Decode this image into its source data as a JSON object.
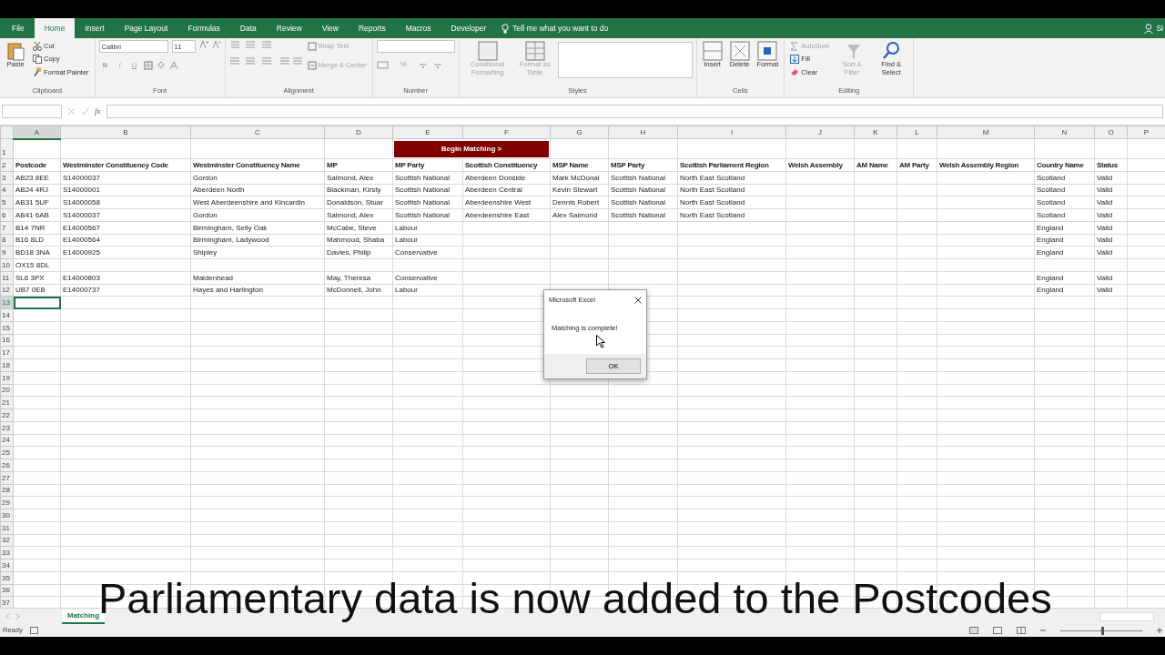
{
  "menu_tabs": [
    {
      "label": "File",
      "selected": false
    },
    {
      "label": "Home",
      "selected": true
    },
    {
      "label": "Insert",
      "selected": false
    },
    {
      "label": "Page Layout",
      "selected": false
    },
    {
      "label": "Formulas",
      "selected": false
    },
    {
      "label": "Data",
      "selected": false
    },
    {
      "label": "Review",
      "selected": false
    },
    {
      "label": "View",
      "selected": false
    },
    {
      "label": "Reports",
      "selected": false
    },
    {
      "label": "Macros",
      "selected": false
    },
    {
      "label": "Developer",
      "selected": false
    }
  ],
  "tell_me": "Tell me what you want to do",
  "account": "Si",
  "ribbon": [
    {
      "kind": "clipboard",
      "label": "Clipboard",
      "buttons": [
        {
          "label": "Paste",
          "disabled": false
        },
        {
          "label": "Cut",
          "disabled": false
        },
        {
          "label": "Copy",
          "disabled": false
        },
        {
          "label": "Format Painter",
          "disabled": false
        }
      ]
    },
    {
      "kind": "font",
      "label": "Font",
      "font": "Calibri",
      "size": "11",
      "buttons": [
        {
          "label": "B",
          "disabled": true
        },
        {
          "label": "I",
          "disabled": true
        },
        {
          "label": "U",
          "disabled": true
        }
      ]
    },
    {
      "kind": "alignment",
      "label": "Alignment",
      "buttons": [
        {
          "label": "Wrap Text",
          "disabled": true
        },
        {
          "label": "Merge & Center",
          "disabled": true
        }
      ]
    },
    {
      "kind": "number",
      "label": "Number",
      "buttons": [
        {
          "label": "%",
          "disabled": true
        }
      ]
    },
    {
      "kind": "styles",
      "label": "Styles",
      "buttons": [
        {
          "label": "Conditional Formatting",
          "disabled": true
        },
        {
          "label": "Format as Table",
          "disabled": true
        }
      ]
    },
    {
      "kind": "cells",
      "label": "Cells",
      "buttons": [
        {
          "label": "Insert",
          "disabled": false
        },
        {
          "label": "Delete",
          "disabled": false
        },
        {
          "label": "Format",
          "disabled": false
        }
      ]
    },
    {
      "kind": "editing",
      "label": "Editing",
      "buttons": [
        {
          "label": "AutoSum",
          "disabled": true
        },
        {
          "label": "Fill",
          "disabled": false
        },
        {
          "label": "Clear",
          "disabled": false
        },
        {
          "label": "Sort & Filter",
          "disabled": true
        },
        {
          "label": "Find & Select",
          "disabled": false
        }
      ]
    }
  ],
  "formula_bar": {
    "function_label": "fx"
  },
  "columns": [
    {
      "letter": "A",
      "selected": true
    },
    {
      "letter": "B",
      "selected": false
    },
    {
      "letter": "C",
      "selected": false
    },
    {
      "letter": "D",
      "selected": false
    },
    {
      "letter": "E",
      "selected": false
    },
    {
      "letter": "F",
      "selected": false
    },
    {
      "letter": "G",
      "selected": false
    },
    {
      "letter": "H",
      "selected": false
    },
    {
      "letter": "I",
      "selected": false
    },
    {
      "letter": "J",
      "selected": false
    },
    {
      "letter": "K",
      "selected": false
    },
    {
      "letter": "L",
      "selected": false
    },
    {
      "letter": "M",
      "selected": false
    },
    {
      "letter": "N",
      "selected": false
    },
    {
      "letter": "O",
      "selected": false
    },
    {
      "letter": "P",
      "selected": false
    }
  ],
  "rows": [
    {
      "number": "1",
      "selected": false,
      "kind": "button",
      "button": "Begin Matching >"
    },
    {
      "number": "2",
      "selected": false,
      "kind": "header",
      "cells": [
        "Postcode",
        "Westminster Constituency Code",
        "Westminster Constituency Name",
        "MP",
        "MP Party",
        "Scottish Constituency",
        "MSP Name",
        "MSP Party",
        "Scottish Parliament Region",
        "Welsh Assembly",
        "AM Name",
        "AM Party",
        "Welsh Assembly Region",
        "Country Name",
        "Status"
      ]
    },
    {
      "number": "3",
      "selected": false,
      "kind": "data",
      "cells": [
        "AB23 8EE",
        "S14000037",
        "Gordon",
        "Salmond, Alex",
        "Scottish National",
        "Aberdeen Donside",
        "Mark McDonal",
        "Scottish National",
        "North East Scotland",
        null,
        null,
        null,
        null,
        "Scotland",
        "Valid"
      ]
    },
    {
      "number": "4",
      "selected": false,
      "kind": "data",
      "cells": [
        "AB24 4RJ",
        "S14000001",
        "Aberdeen North",
        "Blackman, Kirsty",
        "Scottish National",
        "Aberdeen Central",
        "Kevin Stewart",
        "Scottish National",
        "North East Scotland",
        null,
        null,
        null,
        null,
        "Scotland",
        "Valid"
      ]
    },
    {
      "number": "5",
      "selected": false,
      "kind": "data",
      "cells": [
        "AB31 5UF",
        "S14000058",
        "West Aberdeenshire and Kincardin",
        "Donaldson, Stuar",
        "Scottish National",
        "Aberdeenshire West",
        "Dennis Robert",
        "Scottish National",
        "North East Scotland",
        null,
        null,
        null,
        null,
        "Scotland",
        "Valid"
      ]
    },
    {
      "number": "6",
      "selected": false,
      "kind": "data",
      "cells": [
        "AB41 6AB",
        "S14000037",
        "Gordon",
        "Salmond, Alex",
        "Scottish National",
        "Aberdeenshire East",
        "Alex Salmond",
        "Scottish National",
        "North East Scotland",
        null,
        null,
        null,
        null,
        "Scotland",
        "Valid"
      ]
    },
    {
      "number": "7",
      "selected": false,
      "kind": "data",
      "cells": [
        "B14 7NR",
        "E14000567",
        "Birmingham, Selly Oak",
        "McCabe, Steve",
        "Labour",
        null,
        null,
        null,
        null,
        null,
        null,
        null,
        null,
        "England",
        "Valid"
      ]
    },
    {
      "number": "8",
      "selected": false,
      "kind": "data",
      "cells": [
        "B16 8LD",
        "E14000564",
        "Birmingham, Ladywood",
        "Mahmood, Shaba",
        "Labour",
        null,
        null,
        null,
        null,
        null,
        null,
        null,
        null,
        "England",
        "Valid"
      ]
    },
    {
      "number": "9",
      "selected": false,
      "kind": "data",
      "cells": [
        "BD18 3NA",
        "E14000925",
        "Shipley",
        "Davies, Philip",
        "Conservative",
        null,
        null,
        null,
        null,
        null,
        null,
        null,
        null,
        "England",
        "Valid"
      ]
    },
    {
      "number": "10",
      "selected": false,
      "kind": "data",
      "cells": [
        "OX15 8DL",
        null,
        null,
        null,
        null,
        null,
        null,
        null,
        null,
        null,
        null,
        null,
        null,
        null,
        null
      ]
    },
    {
      "number": "11",
      "selected": false,
      "kind": "data",
      "cells": [
        "SL6 3PX",
        "E14000803",
        "Maidenhead",
        "May, Theresa",
        "Conservative",
        null,
        null,
        null,
        null,
        null,
        null,
        null,
        null,
        "England",
        "Valid"
      ]
    },
    {
      "number": "12",
      "selected": false,
      "kind": "data",
      "cells": [
        "UB7 0EB",
        "E14000737",
        "Hayes and Harlington",
        "McDonnell, John",
        "Labour",
        null,
        null,
        null,
        null,
        null,
        null,
        null,
        null,
        "England",
        "Valid"
      ]
    },
    {
      "number": "13",
      "selected": true
    },
    {
      "number": "14",
      "selected": false
    },
    {
      "number": "15",
      "selected": false
    },
    {
      "number": "16",
      "selected": false
    },
    {
      "number": "17",
      "selected": false
    },
    {
      "number": "18",
      "selected": false
    },
    {
      "number": "19",
      "selected": false
    },
    {
      "number": "20",
      "selected": false
    },
    {
      "number": "21",
      "selected": false
    },
    {
      "number": "22",
      "selected": false
    },
    {
      "number": "23",
      "selected": false
    },
    {
      "number": "24",
      "selected": false
    },
    {
      "number": "25",
      "selected": false
    },
    {
      "number": "26",
      "selected": false
    },
    {
      "number": "27",
      "selected": false
    },
    {
      "number": "28",
      "selected": false
    },
    {
      "number": "29",
      "selected": false
    },
    {
      "number": "30",
      "selected": false
    },
    {
      "number": "31",
      "selected": false
    },
    {
      "number": "32",
      "selected": false
    },
    {
      "number": "33",
      "selected": false
    },
    {
      "number": "34",
      "selected": false
    },
    {
      "number": "35",
      "selected": false
    },
    {
      "number": "36",
      "selected": false
    },
    {
      "number": "37",
      "selected": false
    }
  ],
  "dialog": {
    "title": "Microsoft Excel",
    "message": "Matching is complete!",
    "button": "OK"
  },
  "sheet_tabs": [
    {
      "label": "Matching",
      "selected": true
    }
  ],
  "status_bar": {
    "text": "Ready",
    "zoom": {
      "level": 0.5
    }
  },
  "caption": "Parliamentary data is now added to the Postcodes"
}
